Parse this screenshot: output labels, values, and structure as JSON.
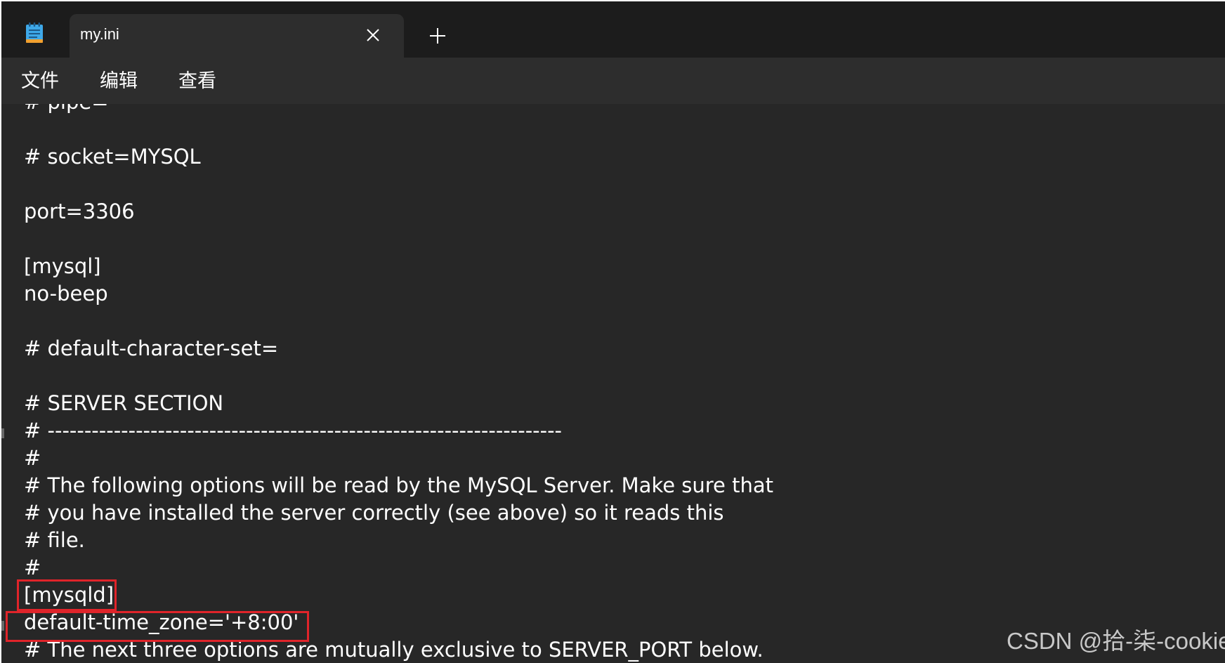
{
  "window": {
    "tab_title": "my.ini"
  },
  "menu": {
    "file": "文件",
    "edit": "编辑",
    "view": "查看"
  },
  "editor": {
    "lines": [
      "# pipe=",
      "",
      "# socket=MYSQL",
      "",
      "port=3306",
      "",
      "[mysql]",
      "no-beep",
      "",
      "# default-character-set=",
      "",
      "# SERVER SECTION",
      "# ----------------------------------------------------------------------",
      "#",
      "# The following options will be read by the MySQL Server. Make sure that",
      "# you have installed the server correctly (see above) so it reads this",
      "# file.",
      "#",
      "[mysqld]",
      "default-time_zone='+8:00'",
      "# The next three options are mutually exclusive to SERVER_PORT below."
    ]
  },
  "watermark": "CSDN @拾-柒-cookie",
  "colors": {
    "background": "#272727",
    "tabbar": "#1c1c1c",
    "highlight_box": "#e0242a",
    "text": "#ffffff"
  },
  "icons": {
    "app": "notepad-icon",
    "close": "close-icon",
    "new_tab": "plus-icon"
  }
}
